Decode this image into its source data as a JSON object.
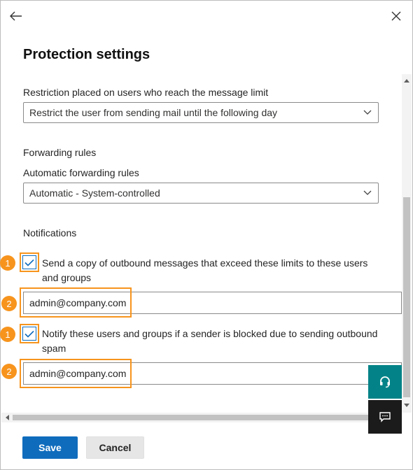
{
  "panel": {
    "title": "Protection settings"
  },
  "restriction": {
    "label": "Restriction placed on users who reach the message limit",
    "value": "Restrict the user from sending mail until the following day"
  },
  "forwarding": {
    "section_label": "Forwarding rules",
    "auto_label": "Automatic forwarding rules",
    "value": "Automatic - System-controlled"
  },
  "notifications": {
    "section_label": "Notifications",
    "copy_checkbox": {
      "checked": true,
      "line1": "Send a copy of outbound messages that exceed these limits to these users",
      "line2": "and groups"
    },
    "copy_recipients": "admin@company.com",
    "notify_checkbox": {
      "checked": true,
      "line1": "Notify these users and groups if a sender is blocked due to sending outbound",
      "line2": "spam"
    },
    "notify_recipients": "admin@company.com"
  },
  "callouts": {
    "one": "1",
    "two": "2"
  },
  "footer": {
    "save_label": "Save",
    "cancel_label": "Cancel"
  },
  "icons": {
    "back": "back-arrow-icon",
    "close": "close-icon",
    "chevron": "chevron-down-icon",
    "check": "checkmark-icon",
    "support": "headset-icon",
    "feedback": "feedback-icon"
  },
  "colors": {
    "accent": "#0f6cbd",
    "callout": "#f7941d",
    "support_button": "#038387",
    "feedback_button": "#1b1b1b"
  }
}
